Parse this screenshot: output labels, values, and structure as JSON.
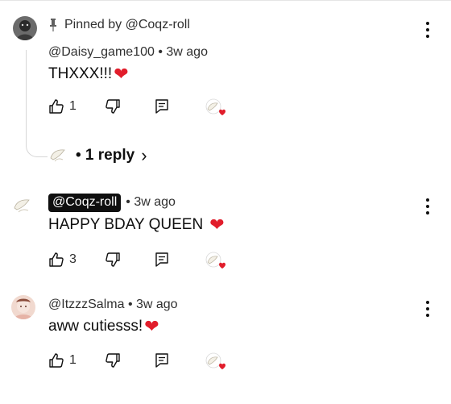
{
  "colors": {
    "heart": "#e11d2b",
    "owner_chip_bg": "#0f0f0f",
    "text": "#0f0f0f",
    "meta": "#303030"
  },
  "pinned": {
    "label": "Pinned by @Coqz-roll"
  },
  "comments": [
    {
      "handle": "@Daisy_game100",
      "time": "• 3w ago",
      "text": "THXXX!!!",
      "heart": "❤",
      "likes": "1"
    },
    {
      "handle": "@Coqz-roll",
      "time": "• 3w ago",
      "text": "HAPPY BDAY QUEEN",
      "heart": "❤",
      "likes": "3"
    },
    {
      "handle": "@ItzzzSalma",
      "time": "• 3w ago",
      "text": "aww cutiesss!",
      "heart": "❤",
      "likes": "1"
    }
  ],
  "replies": {
    "label": "• 1 reply",
    "chevron": "›"
  },
  "icons": {
    "like": "thumbs-up-icon",
    "dislike": "thumbs-down-icon",
    "reply": "reply-comment-icon",
    "creator_heart": "creator-heart-icon",
    "more": "more-vert-icon",
    "pin": "pin-icon"
  }
}
